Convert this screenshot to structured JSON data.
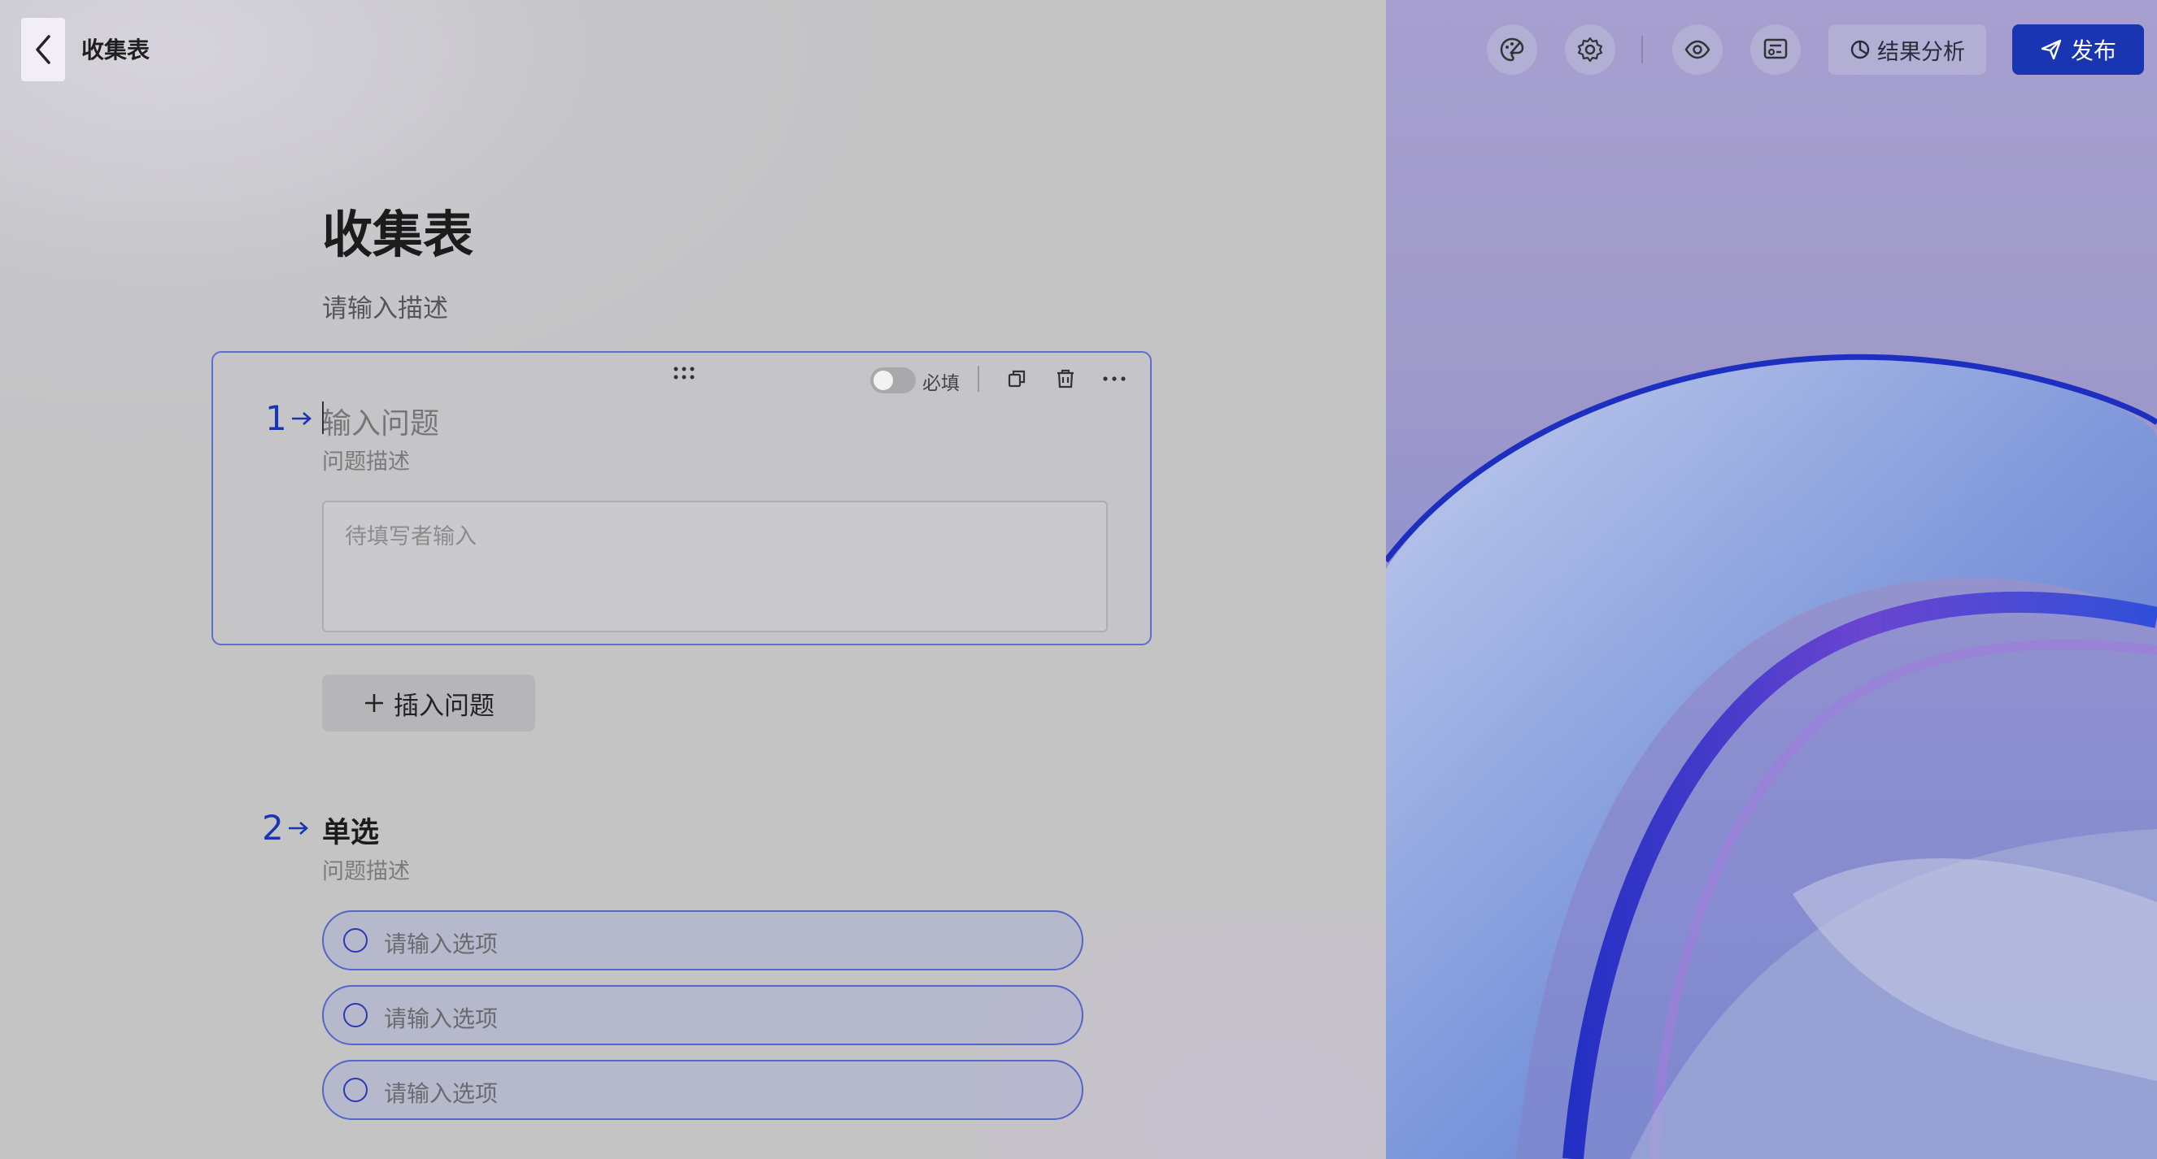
{
  "header": {
    "app_title": "收集表",
    "toolbar": {
      "analysis_label": "结果分析",
      "publish_label": "发布",
      "icons": [
        "palette-icon",
        "gear-icon",
        "eye-icon",
        "form-preview-icon"
      ]
    }
  },
  "form": {
    "title": "收集表",
    "description": "请输入描述"
  },
  "questions": [
    {
      "number": "1",
      "title_placeholder": "输入问题",
      "description": "问题描述",
      "required_label": "必填",
      "answer_placeholder": "待填写者输入"
    },
    {
      "number": "2",
      "title": "单选",
      "description": "问题描述",
      "options": [
        "请输入选项",
        "请输入选项",
        "请输入选项"
      ]
    }
  ],
  "insert_question_label": "插入问题",
  "colors": {
    "accent": "#1a35b2",
    "card_border": "#5d6ed0"
  }
}
